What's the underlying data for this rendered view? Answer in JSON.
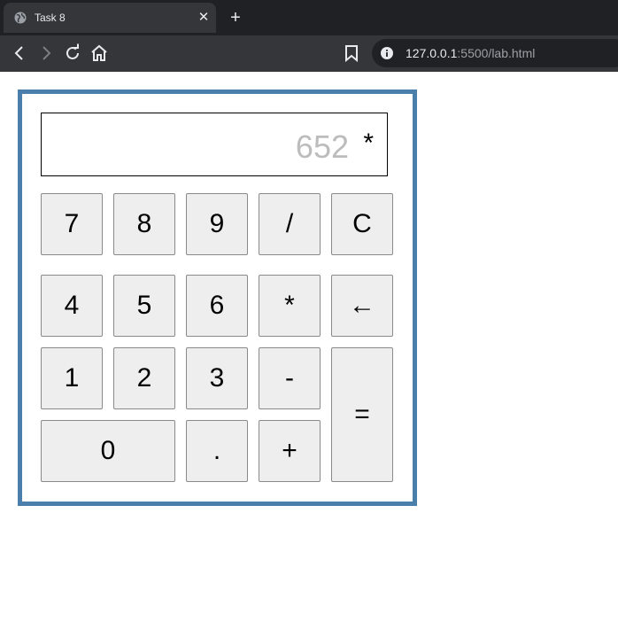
{
  "browser": {
    "tab_title": "Task 8",
    "tab_close": "✕",
    "new_tab": "+",
    "url_host": "127.0.0.1",
    "url_path": ":5500/lab.html"
  },
  "calculator": {
    "display_value": "652",
    "display_operator": "*",
    "keys": {
      "k7": "7",
      "k8": "8",
      "k9": "9",
      "divide": "/",
      "clear": "C",
      "k4": "4",
      "k5": "5",
      "k6": "6",
      "multiply": "*",
      "backspace": "←",
      "k1": "1",
      "k2": "2",
      "k3": "3",
      "subtract": "-",
      "equals": "=",
      "k0": "0",
      "decimal": ".",
      "add": "+"
    }
  }
}
